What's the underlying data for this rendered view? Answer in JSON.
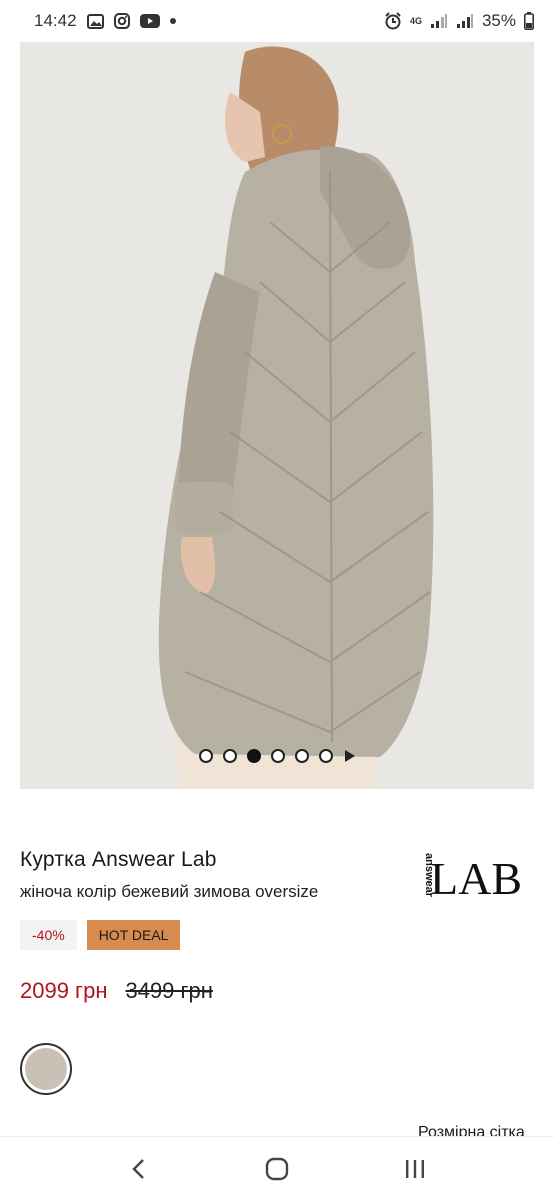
{
  "status_bar": {
    "time": "14:42",
    "notification_icons": [
      "gallery-icon",
      "instagram-icon",
      "youtube-icon",
      "dot-icon"
    ],
    "network_type": "4G",
    "battery": "35%"
  },
  "gallery": {
    "image_alt": "Model wearing long beige quilted oversize puffer coat, back view",
    "total_slides": 6,
    "active_slide": 3
  },
  "product": {
    "title": "Куртка Answear Lab",
    "subtitle": "жіноча колір бежевий зимова oversize",
    "brand_logo_side_text": "answear",
    "brand_logo_text": "LAB",
    "discount_badge": "-40%",
    "hot_badge": "HOT DEAL",
    "price_current": "2099 грн",
    "price_old": "3499 грн",
    "colors": {
      "accent_red": "#b0141e",
      "hot_deal_bg": "#d88b4f",
      "swatch": "#c9c1b6"
    },
    "size_chart_link": "Розмірна сітка"
  },
  "nav_bar": {
    "back": "back-icon",
    "home": "home-icon",
    "recents": "recents-icon"
  }
}
